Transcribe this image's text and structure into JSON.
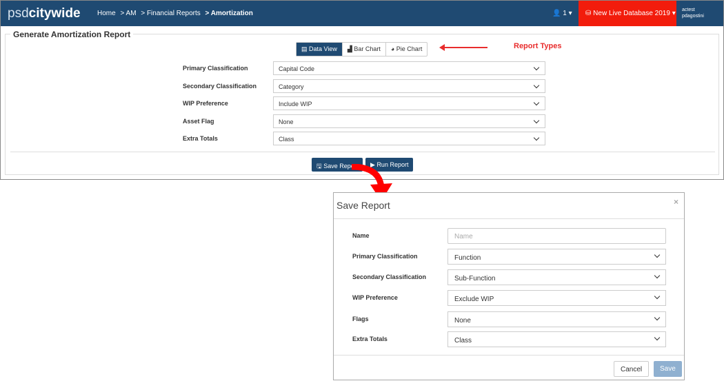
{
  "nav": {
    "logo_light": "psd",
    "logo_bold": "citywide",
    "breadcrumbs": [
      "Home",
      "> AM",
      "> Financial Reports",
      "> Amortization"
    ],
    "users_count": "1",
    "database": "New Live Database 2019",
    "account_line1": "actest",
    "account_line2": "pdagostini"
  },
  "panel": {
    "title": "Generate Amortization Report",
    "report_types": [
      "Data View",
      "Bar Chart",
      "Pie Chart"
    ],
    "annotation": "Report Types",
    "fields": [
      {
        "label": "Primary Classification",
        "value": "Capital Code"
      },
      {
        "label": "Secondary Classification",
        "value": "Category"
      },
      {
        "label": "WIP Preference",
        "value": "Include WIP"
      },
      {
        "label": "Asset Flag",
        "value": "None"
      },
      {
        "label": "Extra Totals",
        "value": "Class"
      }
    ],
    "save_label": "Save Report",
    "run_label": "Run Report"
  },
  "modal": {
    "title": "Save Report",
    "close": "×",
    "name_label": "Name",
    "name_placeholder": "Name",
    "fields": [
      {
        "label": "Primary Classification",
        "value": "Function"
      },
      {
        "label": "Secondary Classification",
        "value": "Sub-Function"
      },
      {
        "label": "WIP Preference",
        "value": "Exclude WIP"
      },
      {
        "label": "Flags",
        "value": "None"
      },
      {
        "label": "Extra Totals",
        "value": "Class"
      }
    ],
    "cancel_label": "Cancel",
    "save_label": "Save"
  },
  "colors": {
    "nav": "#1f4a72",
    "db": "#f21c0c",
    "annotation": "#e82c2c"
  }
}
